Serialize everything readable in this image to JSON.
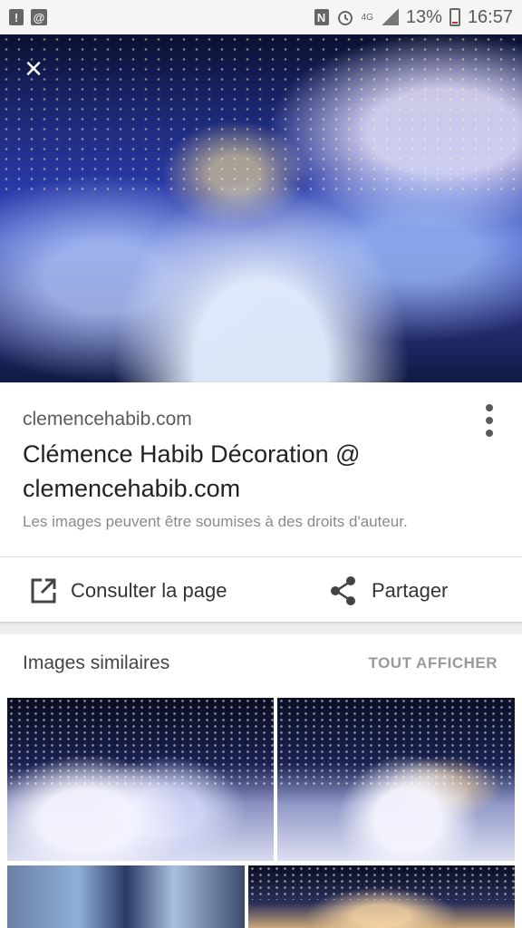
{
  "status_bar": {
    "left_icons": [
      "alert-icon",
      "at-icon"
    ],
    "right_icons": [
      "nfc-icon",
      "alarm-icon",
      "signal-icon",
      "battery-icon"
    ],
    "network": "4G",
    "battery_pct": "13%",
    "time": "16:57"
  },
  "hero": {
    "close_icon": "close-icon",
    "close_glyph": "×"
  },
  "result": {
    "domain": "clemencehabib.com",
    "title": "Clémence Habib Décoration @ clemencehabib.com",
    "copyright": "Les images peuvent être soumises à des droits d'auteur.",
    "actions": {
      "visit_label": "Consulter la page",
      "share_label": "Partager"
    }
  },
  "similar": {
    "title": "Images similaires",
    "see_all": "TOUT AFFICHER"
  },
  "colors": {
    "accent_text": "#222222",
    "muted": "#8a8a8a",
    "see_all": "#999999"
  }
}
